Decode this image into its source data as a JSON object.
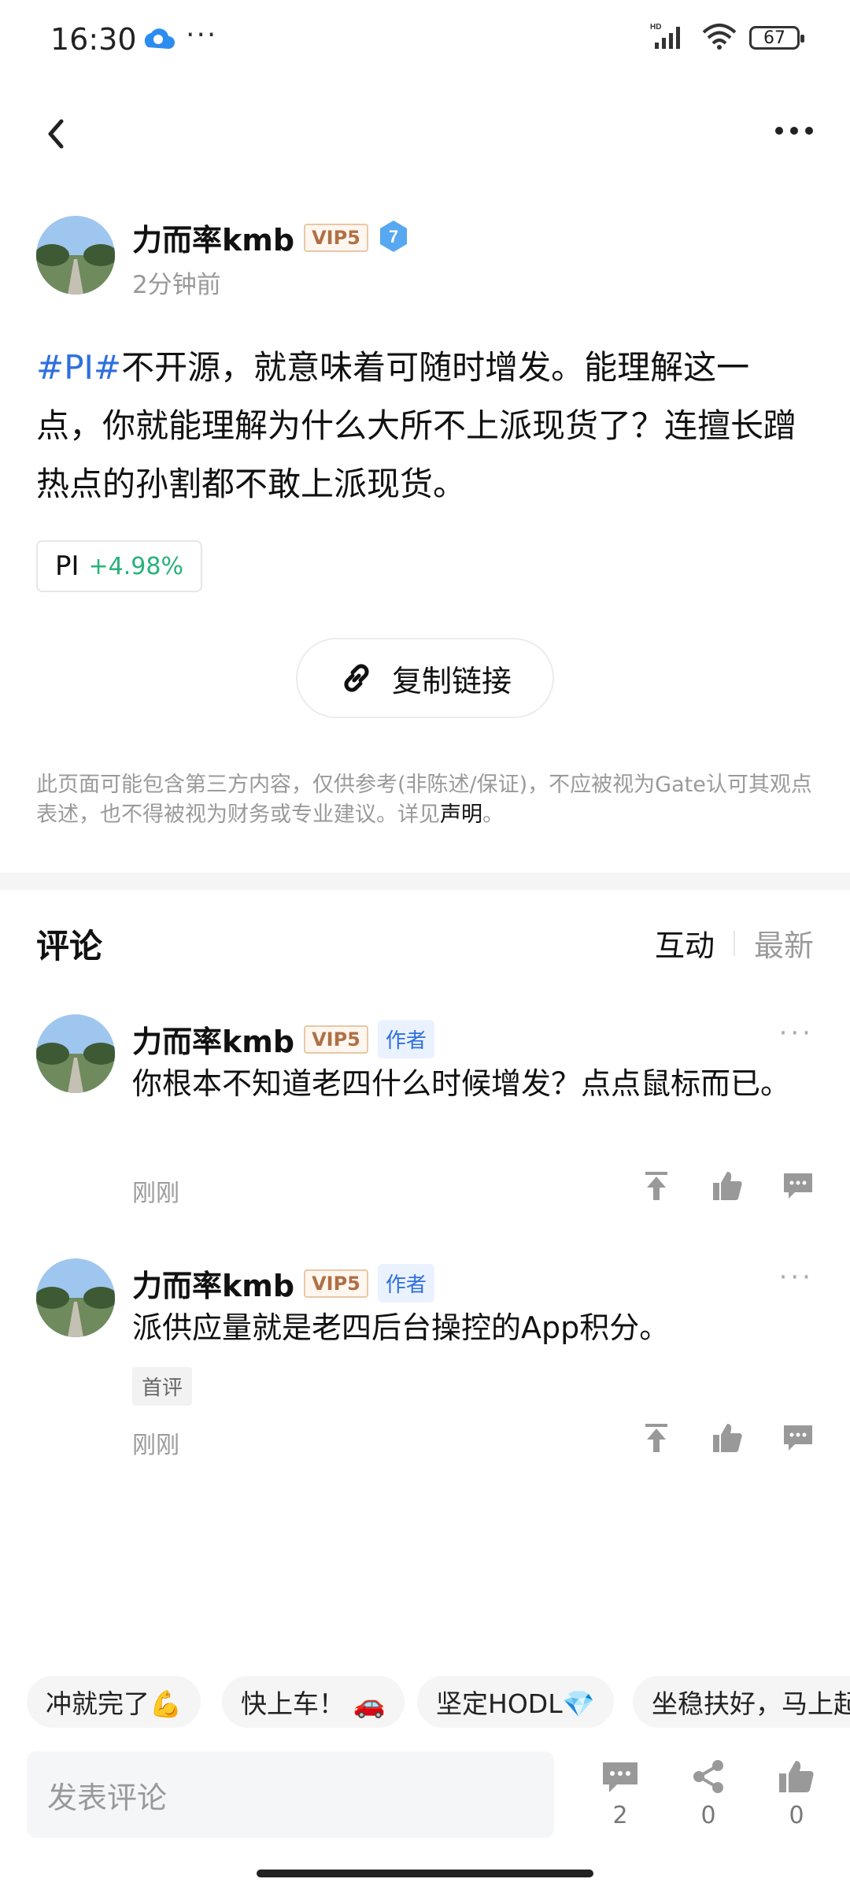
{
  "status_bar": {
    "time": "16:30",
    "dots": "···",
    "battery": "67",
    "network": "HD"
  },
  "post": {
    "author": {
      "name": "力而率kmb",
      "vip": "VIP5",
      "level": "7",
      "time": "2分钟前"
    },
    "hashtag": "#PI#",
    "text": "不开源，就意味着可随时增发。能理解这一点，你就能理解为什么大所不上派现货了？连擅长蹭热点的孙割都不敢上派现货。",
    "coin": {
      "name": "PI",
      "change": "+4.98%",
      "change_color": "#27b27a"
    },
    "copy_link_label": "复制链接",
    "disclaimer_text": "此页面可能包含第三方内容，仅供参考(非陈述/保证)，不应被视为Gate认可其观点表述，也不得被视为财务或专业建议。详见",
    "disclaimer_link": "声明",
    "disclaimer_end": "。"
  },
  "comments_section": {
    "title": "评论",
    "sort_active": "互动",
    "sort_inactive": "最新",
    "comments": [
      {
        "name": "力而率kmb",
        "vip": "VIP5",
        "badge": "作者",
        "text": "你根本不知道老四什么时候增发？点点鼠标而已。",
        "time": "刚刚",
        "more": "···"
      },
      {
        "name": "力而率kmb",
        "vip": "VIP5",
        "badge": "作者",
        "text": "派供应量就是老四后台操控的App积分。",
        "first_badge": "首评",
        "time": "刚刚",
        "more": "···"
      }
    ]
  },
  "quick_replies": [
    "冲就完了💪",
    "快上车！ 🚗",
    "坚定HODL💎",
    "坐稳扶好，马上起"
  ],
  "bottom_bar": {
    "input_placeholder": "发表评论",
    "comments_count": "2",
    "share_count": "0",
    "like_count": "0"
  },
  "colors": {
    "accent": "#2f6fde",
    "positive": "#27b27a",
    "muted": "#9a9a9a"
  }
}
